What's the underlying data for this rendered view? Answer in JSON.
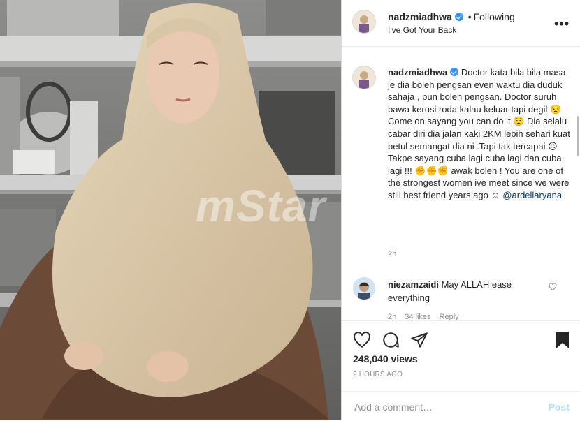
{
  "post": {
    "username": "nadzmiadhwa",
    "follow_separator": "•",
    "follow_status": "Following",
    "audio_label": "I've Got Your Back"
  },
  "caption": {
    "username": "nadzmiadhwa",
    "text": "Doctor kata bila bila masa je dia boleh pengsan even waktu dia duduk sahaja , pun boleh pengsan. Doctor suruh bawa kerusi roda kalau keluar tapi degil 😒 Come on sayang you can do it 😟 Dia selalu cabar diri dia jalan kaki 2KM lebih sehari kuat betul semangat dia ni .Tapi tak tercapai ☹ Takpe sayang cuba lagi cuba lagi dan cuba lagi !!! ✊✊✊ awak boleh ! You are one of the strongest women ive meet since we were still best friend years ago ☺",
    "mention": "@ardellaryana",
    "time": "2h"
  },
  "comment": {
    "username": "niezamzaidi",
    "text": "May ALLAH ease everything",
    "time": "2h",
    "likes": "34 likes",
    "reply": "Reply"
  },
  "stats": {
    "views": "248,040 views",
    "posted_ago": "2 HOURS AGO"
  },
  "add_comment": {
    "placeholder": "Add a comment…",
    "post_label": "Post"
  },
  "watermark": "mStar",
  "icons": [
    "heart-icon",
    "comment-icon",
    "share-icon",
    "bookmark-icon",
    "more-icon",
    "verified-badge-icon"
  ],
  "colors": {
    "verified": "#3897f0",
    "post_disabled": "#b2dffc",
    "muted": "#8e8e8e",
    "hijab": "#d9c6a6",
    "robe": "#6b4a38"
  }
}
